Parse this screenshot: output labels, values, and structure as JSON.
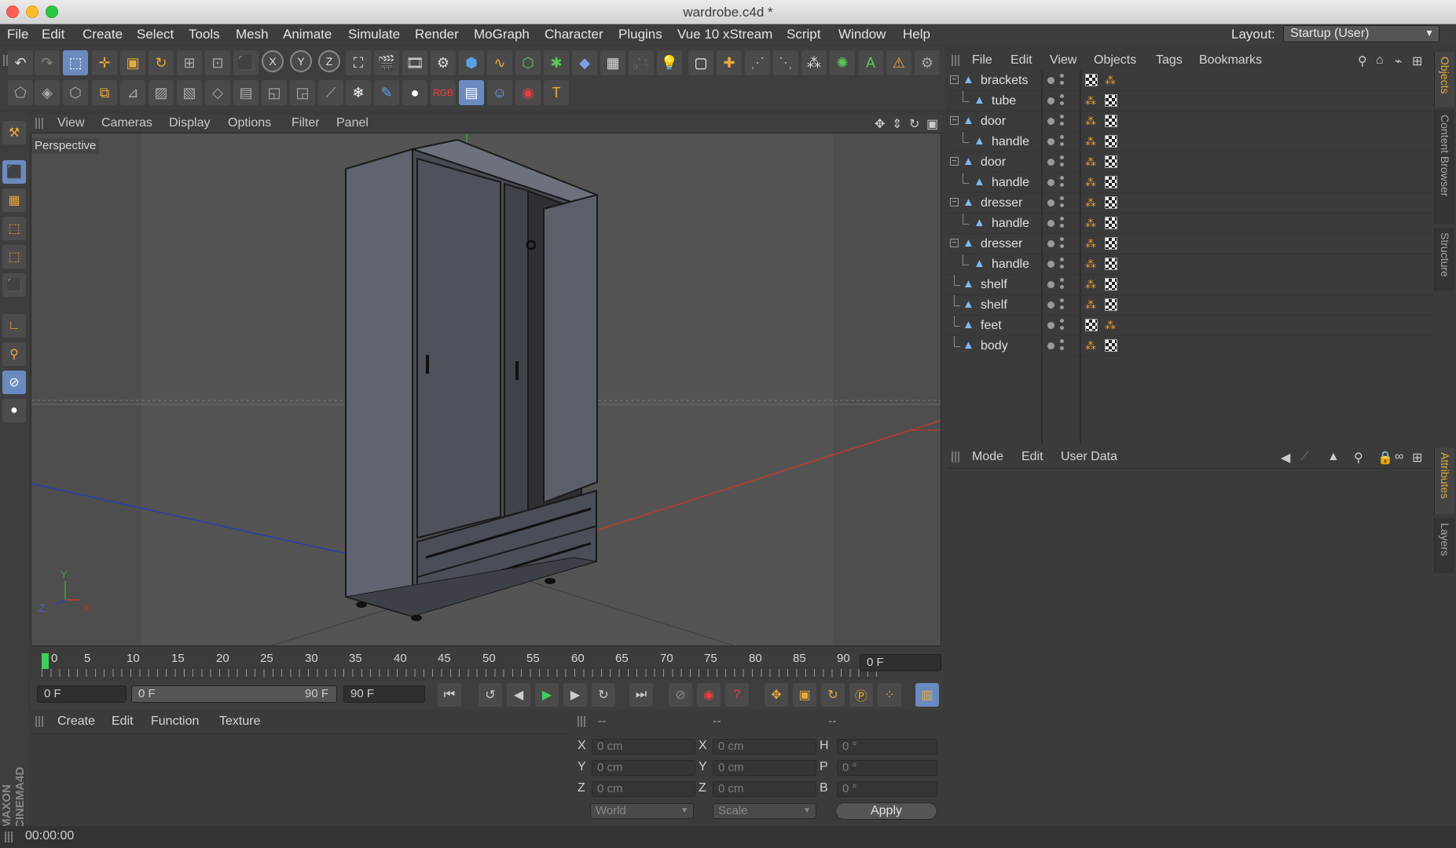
{
  "window": {
    "title": "wardrobe.c4d *"
  },
  "menubar": {
    "items": [
      "File",
      "Edit",
      "Create",
      "Select",
      "Tools",
      "Mesh",
      "Animate",
      "Simulate",
      "Render",
      "MoGraph",
      "Character",
      "Plugins",
      "Vue 10 xStream",
      "Script",
      "Window",
      "Help"
    ],
    "layout_label": "Layout:",
    "layout_value": "Startup (User)"
  },
  "viewport": {
    "menu": [
      "View",
      "Cameras",
      "Display",
      "Options",
      "Filter",
      "Panel"
    ],
    "camera_label": "Perspective"
  },
  "timeline": {
    "ticks": [
      "0",
      "5",
      "10",
      "15",
      "20",
      "25",
      "30",
      "35",
      "40",
      "45",
      "50",
      "55",
      "60",
      "65",
      "70",
      "75",
      "80",
      "85",
      "90"
    ],
    "current_frame": "0 F",
    "start_field": "0 F",
    "range_start": "0 F",
    "range_end": "90 F",
    "end_field": "90 F"
  },
  "objects_panel": {
    "menu": [
      "File",
      "Edit",
      "View",
      "Objects",
      "Tags",
      "Bookmarks"
    ],
    "items": [
      {
        "name": "brackets",
        "level": 0
      },
      {
        "name": "tube",
        "level": 1
      },
      {
        "name": "door",
        "level": 0
      },
      {
        "name": "handle",
        "level": 1
      },
      {
        "name": "door",
        "level": 0
      },
      {
        "name": "handle",
        "level": 1
      },
      {
        "name": "dresser",
        "level": 0
      },
      {
        "name": "handle",
        "level": 1
      },
      {
        "name": "dresser",
        "level": 0
      },
      {
        "name": "handle",
        "level": 1
      },
      {
        "name": "shelf",
        "level": 0
      },
      {
        "name": "shelf",
        "level": 0
      },
      {
        "name": "feet",
        "level": 0
      },
      {
        "name": "body",
        "level": 0
      }
    ]
  },
  "side_tabs_top": [
    "Objects",
    "Content Browser",
    "Structure"
  ],
  "side_tabs_bottom": [
    "Attributes",
    "Layers"
  ],
  "attributes_panel": {
    "menu": [
      "Mode",
      "Edit",
      "User Data"
    ]
  },
  "materials_panel": {
    "menu": [
      "Create",
      "Edit",
      "Function",
      "Texture"
    ]
  },
  "coordinates": {
    "headers": [
      "--",
      "--",
      "--"
    ],
    "rows": [
      {
        "l1": "X",
        "v1": "0 cm",
        "l2": "X",
        "v2": "0 cm",
        "l3": "H",
        "v3": "0 °"
      },
      {
        "l1": "Y",
        "v1": "0 cm",
        "l2": "Y",
        "v2": "0 cm",
        "l3": "P",
        "v3": "0 °"
      },
      {
        "l1": "Z",
        "v1": "0 cm",
        "l2": "Z",
        "v2": "0 cm",
        "l3": "B",
        "v3": "0 °"
      }
    ],
    "space": "World",
    "mode": "Scale",
    "apply": "Apply"
  },
  "status": {
    "time": "00:00:00"
  },
  "branding": {
    "maxon": "MAXON CINEMA4D"
  },
  "axes": {
    "y": "Y",
    "z": "Z",
    "x": "X"
  },
  "colors": {
    "accent": "#e8a93b",
    "selection": "#6a8ac0",
    "x_axis": "#c0392b",
    "y_axis": "#3ba33b",
    "z_axis": "#2b3fb0"
  }
}
